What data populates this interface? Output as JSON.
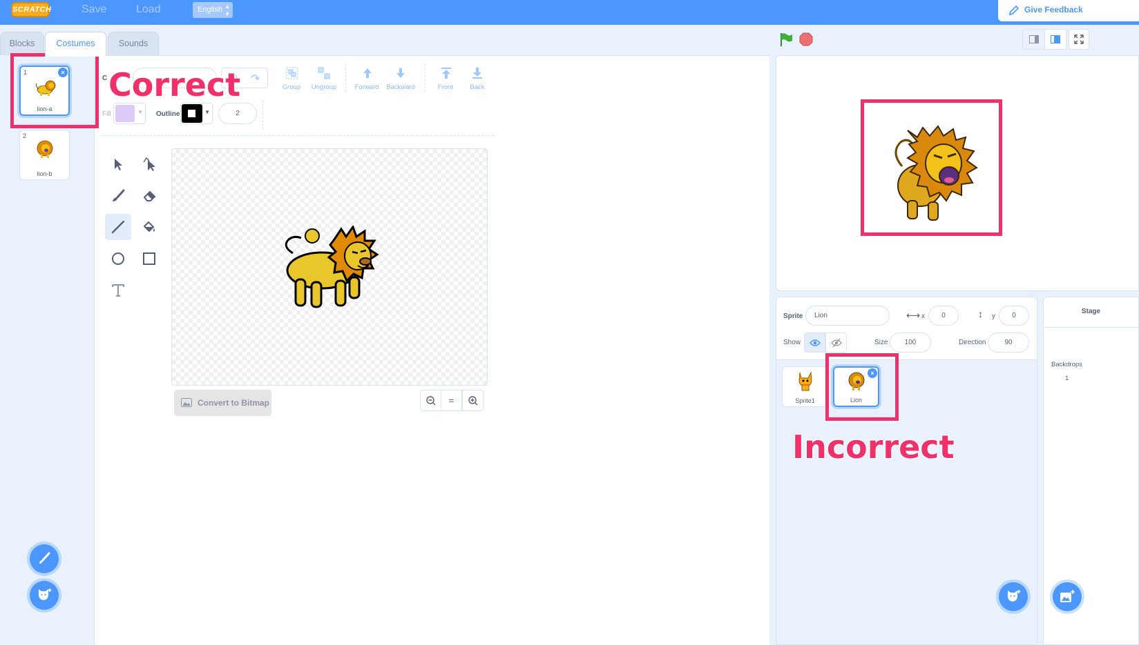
{
  "menubar": {
    "logo_text": "SCRATCH",
    "save_label": "Save",
    "load_label": "Load",
    "language": "English",
    "feedback_label": "Give Feedback"
  },
  "tabs": [
    {
      "label": "Blocks",
      "active": false
    },
    {
      "label": "Costumes",
      "active": true
    },
    {
      "label": "Sounds",
      "active": false
    }
  ],
  "costumes": [
    {
      "number": "1",
      "label": "lion-a",
      "selected": true
    },
    {
      "number": "2",
      "label": "lion-b",
      "selected": false
    }
  ],
  "paint_editor": {
    "costume_name_label_partial": "C",
    "tools_top": [
      {
        "label": "Group"
      },
      {
        "label": "Ungroup"
      },
      {
        "label": "Forward"
      },
      {
        "label": "Backward"
      },
      {
        "label": "Front"
      },
      {
        "label": "Back"
      }
    ],
    "fill_label": "Fill",
    "fill_color": "#dccbf8",
    "outline_label": "Outline",
    "outline_color": "#000000",
    "outline_width": "2",
    "convert_label": "Convert to Bitmap",
    "zoom_equal": "="
  },
  "stage_controls": {
    "green_flag_color": "#3fb03a",
    "stop_color": "#ec6f73"
  },
  "sprite_info": {
    "sprite_label": "Sprite",
    "sprite_name": "Lion",
    "x_label": "x",
    "x_value": "0",
    "y_label": "y",
    "y_value": "0",
    "show_label": "Show",
    "size_label": "Size",
    "size_value": "100",
    "direction_label": "Direction",
    "direction_value": "90"
  },
  "sprites": [
    {
      "label": "Sprite1",
      "selected": false
    },
    {
      "label": "Lion",
      "selected": true
    }
  ],
  "stage_panel": {
    "title": "Stage",
    "backdrops_label": "Backdrops",
    "backdrops_count": "1"
  },
  "annotations": {
    "correct_text": "Correct",
    "incorrect_text": "Incorrect",
    "color": "#f0306a"
  }
}
